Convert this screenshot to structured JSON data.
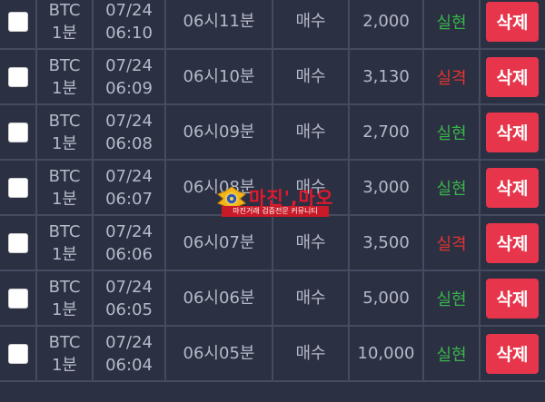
{
  "colors": {
    "background": "#2b3043",
    "grid": "#454b60",
    "text": "#b5bac8",
    "win": "#39b54a",
    "loss": "#e2342f",
    "delete_button": "#e7364b"
  },
  "rows": [
    {
      "coin": "BTC",
      "interval": "1분",
      "date": "07/24",
      "time": "06:10",
      "slot": "06시11분",
      "side": "매수",
      "amount": "2,000",
      "result": "실현",
      "result_type": "win",
      "delete_label": "삭제"
    },
    {
      "coin": "BTC",
      "interval": "1분",
      "date": "07/24",
      "time": "06:09",
      "slot": "06시10분",
      "side": "매수",
      "amount": "3,130",
      "result": "실격",
      "result_type": "loss",
      "delete_label": "삭제"
    },
    {
      "coin": "BTC",
      "interval": "1분",
      "date": "07/24",
      "time": "06:08",
      "slot": "06시09분",
      "side": "매수",
      "amount": "2,700",
      "result": "실현",
      "result_type": "win",
      "delete_label": "삭제"
    },
    {
      "coin": "BTC",
      "interval": "1분",
      "date": "07/24",
      "time": "06:07",
      "slot": "06시08분",
      "side": "매수",
      "amount": "3,000",
      "result": "실현",
      "result_type": "win",
      "delete_label": "삭제"
    },
    {
      "coin": "BTC",
      "interval": "1분",
      "date": "07/24",
      "time": "06:06",
      "slot": "06시07분",
      "side": "매수",
      "amount": "3,500",
      "result": "실격",
      "result_type": "loss",
      "delete_label": "삭제"
    },
    {
      "coin": "BTC",
      "interval": "1분",
      "date": "07/24",
      "time": "06:05",
      "slot": "06시06분",
      "side": "매수",
      "amount": "5,000",
      "result": "실현",
      "result_type": "win",
      "delete_label": "삭제"
    },
    {
      "coin": "BTC",
      "interval": "1분",
      "date": "07/24",
      "time": "06:04",
      "slot": "06시05분",
      "side": "매수",
      "amount": "10,000",
      "result": "실현",
      "result_type": "win",
      "delete_label": "삭제"
    }
  ],
  "watermark": {
    "title": "마진',마오",
    "subtitle": "마진거래 검증전문 커뮤니티",
    "icon": "police-badge-icon"
  }
}
